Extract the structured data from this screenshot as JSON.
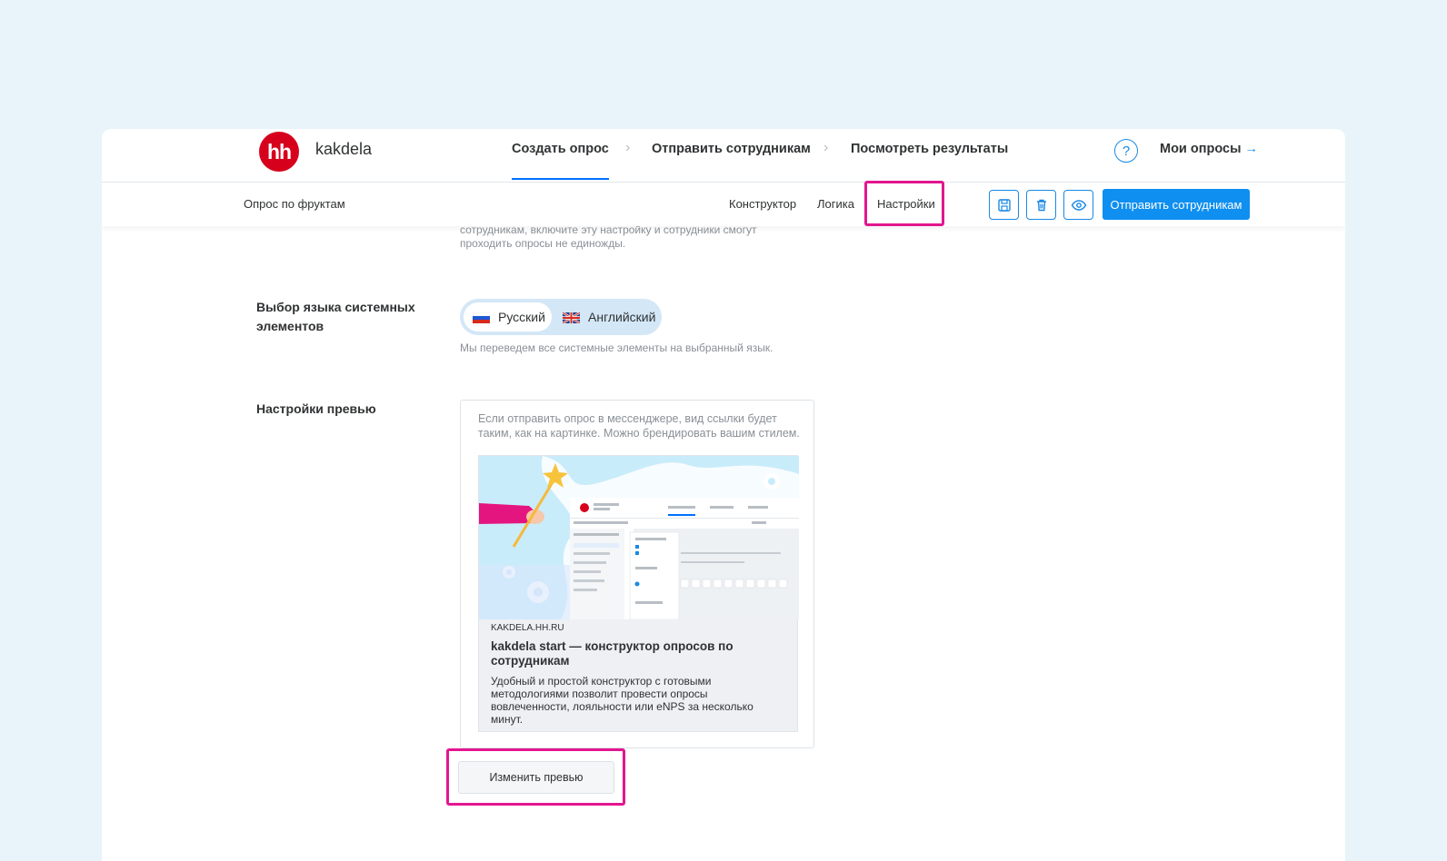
{
  "header": {
    "logo_text": "hh",
    "brand": "kakdela",
    "steps": [
      {
        "label": "Создать опрос"
      },
      {
        "label": "Отправить сотрудникам"
      },
      {
        "label": "Посмотреть результаты"
      }
    ],
    "help_glyph": "?",
    "my_surveys": "Мои опросы",
    "my_surveys_arrow": "→"
  },
  "subheader": {
    "survey_name": "Опрос по фруктам",
    "tabs": [
      {
        "label": "Конструктор"
      },
      {
        "label": "Логика"
      },
      {
        "label": "Настройки",
        "highlighted": true
      }
    ],
    "icons": [
      "save-icon",
      "trash-icon",
      "eye-icon"
    ],
    "send_button": "Отправить сотрудникам"
  },
  "content": {
    "cut_text": "сотрудникам, включите эту настройку и сотрудники смогут проходить опросы не единожды.",
    "language": {
      "label": "Выбор языка системных элементов",
      "options": [
        {
          "label": "Русский",
          "selected": true
        },
        {
          "label": "Английский",
          "selected": false
        }
      ],
      "hint": "Мы переведем все системные элементы на выбранный язык."
    },
    "preview": {
      "label": "Настройки превью",
      "description": "Если отправить опрос в мессенджере, вид ссылки будет таким, как на картинке. Можно брендировать вашим стилем.",
      "card": {
        "domain": "KAKDELA.HH.RU",
        "title": "kakdela start — конструктор опросов по сотрудникам",
        "text": "Удобный и простой конструктор с готовыми методологиями позволит провести опросы вовлеченности, лояльности или eNPS за несколько минут."
      },
      "change_button": "Изменить превью"
    }
  },
  "colors": {
    "accent": "#0f8ff0",
    "highlight": "#e3168f",
    "logo_red": "#d6001c",
    "page_bg": "#e8f3fa"
  }
}
